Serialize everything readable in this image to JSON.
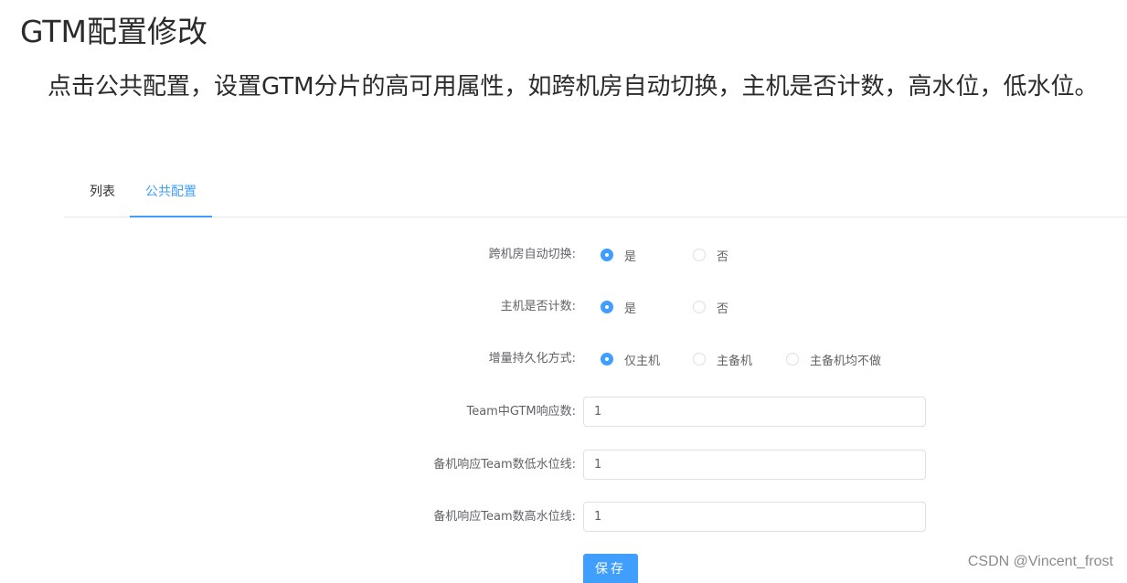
{
  "article": {
    "title": "GTM配置修改",
    "intro": "点击公共配置，设置GTM分片的高可用属性，如跨机房自动切换，主机是否计数，高水位，低水位。"
  },
  "tabs": [
    {
      "label": "列表",
      "active": false
    },
    {
      "label": "公共配置",
      "active": true
    }
  ],
  "form": {
    "cross_room_switch": {
      "label": "跨机房自动切换:",
      "options": [
        "是",
        "否"
      ],
      "selected": "是"
    },
    "host_count": {
      "label": "主机是否计数:",
      "options": [
        "是",
        "否"
      ],
      "selected": "是"
    },
    "persistence_mode": {
      "label": "增量持久化方式:",
      "options": [
        "仅主机",
        "主备机",
        "主备机均不做"
      ],
      "selected": "仅主机"
    },
    "gtm_responses": {
      "label": "Team中GTM响应数:",
      "value": "1"
    },
    "standby_low_watermark": {
      "label": "备机响应Team数低水位线:",
      "value": "1"
    },
    "standby_high_watermark": {
      "label": "备机响应Team数高水位线:",
      "value": "1"
    },
    "save_label": "保存"
  },
  "watermark": "CSDN @Vincent_frost",
  "colors": {
    "accent": "#409eff",
    "border": "#dcdfe6",
    "label": "#606266"
  }
}
